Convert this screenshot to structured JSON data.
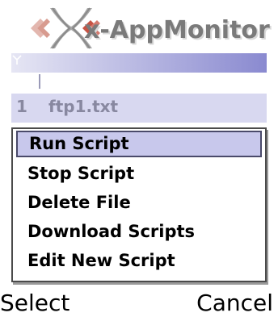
{
  "app": {
    "title": "x-AppMonitor",
    "signal_icon": "signal-antenna-icon",
    "logo_colors": {
      "primary": "#b03020",
      "secondary": "#7a7a7a"
    }
  },
  "list": {
    "items": [
      {
        "index": "1",
        "name": "ftp1.txt"
      }
    ]
  },
  "menu": {
    "items": [
      {
        "label": "Run Script",
        "selected": true
      },
      {
        "label": "Stop Script",
        "selected": false
      },
      {
        "label": "Delete File",
        "selected": false
      },
      {
        "label": "Download Scripts",
        "selected": false
      },
      {
        "label": "Edit New Script",
        "selected": false
      }
    ]
  },
  "softkeys": {
    "left": "Select",
    "right": "Cancel"
  },
  "colors": {
    "highlight": "#c8c8ec",
    "list_bg": "#d8d8f0",
    "strip_start": "#e6e6f4",
    "strip_end": "#8a8ad0"
  }
}
